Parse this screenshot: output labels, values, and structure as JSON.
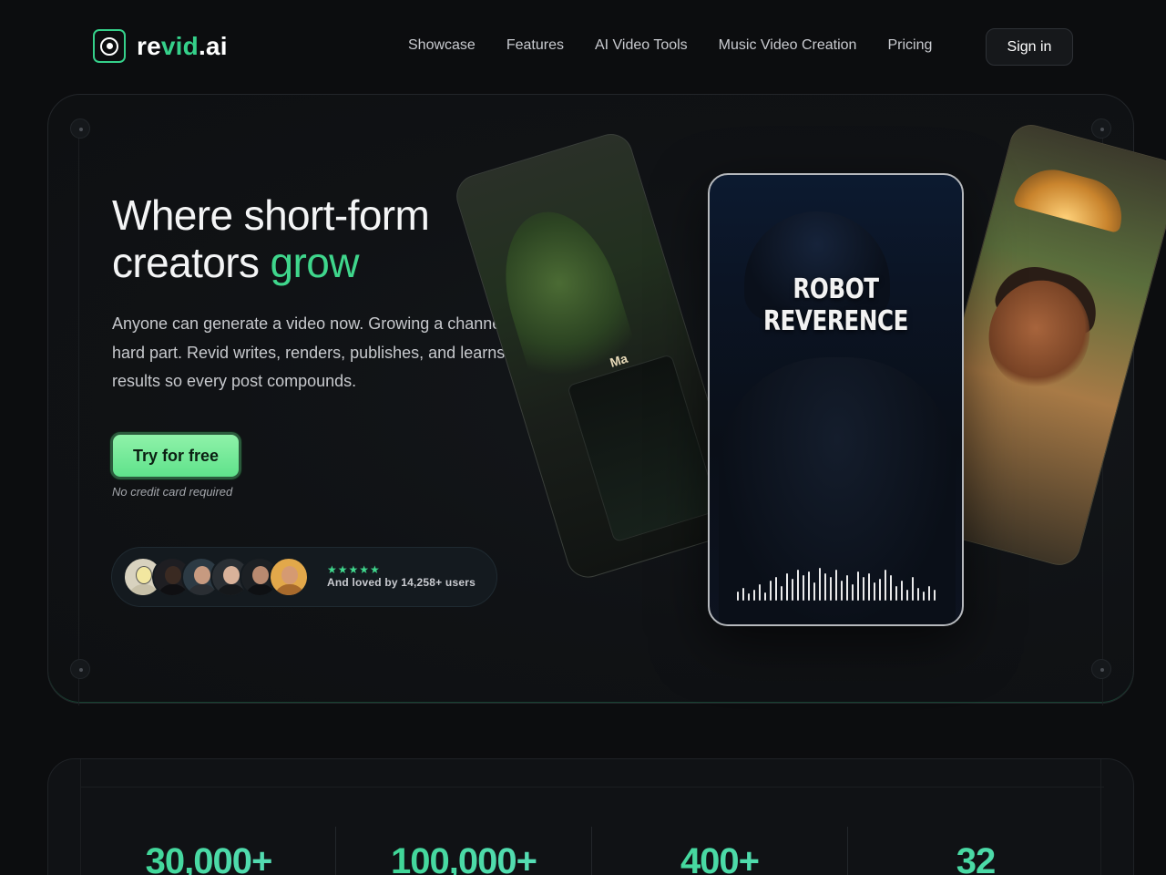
{
  "brand": {
    "name_prefix": "re",
    "name_accent": "vid",
    "name_suffix": ".ai",
    "accent_color": "#35d08a"
  },
  "nav": {
    "links": [
      "Showcase",
      "Features",
      "AI Video Tools",
      "Music Video Creation",
      "Pricing"
    ],
    "signin_label": "Sign in"
  },
  "hero": {
    "headline_line1": "Where short-form",
    "headline_line2_prefix": "creators ",
    "headline_accent": "grow",
    "subtext": "Anyone can generate a video now. Growing a channel is the hard part. Revid writes, renders, publishes, and learns from your results so every post compounds.",
    "cta_label": "Try for free",
    "cta_note": "No credit card required",
    "rating_stars": "★★★★★",
    "social_proof": "And loved by 14,258+ users",
    "showcase": {
      "center_title": "ROBOT REVERENCE",
      "left_fragment": "Ma"
    }
  },
  "stats": [
    "30,000+",
    "100,000+",
    "400+",
    "32"
  ],
  "icons": {
    "logo": "camera-lens-icon",
    "rating": "star-icon"
  }
}
